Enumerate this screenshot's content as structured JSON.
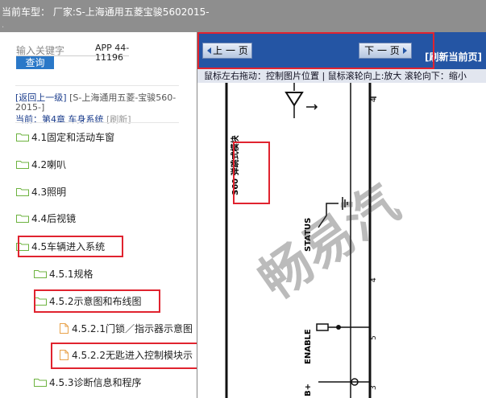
{
  "header": {
    "title": "当前车型：  厂家:S-上海通用五菱宝骏5602015-",
    "dot": "."
  },
  "search": {
    "placeholder": "输入关键字",
    "button": "查询",
    "app_code": "APP 44-11196"
  },
  "nav": {
    "back": "[返回上一级]",
    "vehicle": "[S-上海通用五菱-宝骏560-2015-]",
    "current_prefix": "当前：",
    "current": "第4章 车身系统",
    "refresh": "[刷新]"
  },
  "tree": [
    {
      "label": "4.1固定和活动车窗",
      "icon": "folder-icon"
    },
    {
      "label": "4.2喇叭",
      "icon": "folder-icon"
    },
    {
      "label": "4.3照明",
      "icon": "folder-icon"
    },
    {
      "label": "4.4后视镜",
      "icon": "folder-icon"
    },
    {
      "label": "4.5车辆进入系统",
      "icon": "folder-icon"
    },
    {
      "label": "4.5.1规格",
      "icon": "folder-icon"
    },
    {
      "label": "4.5.2示意图和布线图",
      "icon": "folder-icon"
    },
    {
      "label": "4.5.2.1门锁／指示器示意图",
      "icon": "document-icon"
    },
    {
      "label": "4.5.2.2无匙进入控制模块示",
      "icon": "document-icon"
    },
    {
      "label": "4.5.3诊断信息和程序",
      "icon": "folder-icon"
    }
  ],
  "viewer": {
    "prev": "上 一 页",
    "next": "下 一 页",
    "refresh": "[刷新当前页]",
    "hint": "鼠标左右拖动：控制图片位置 | 鼠标滚轮向上:放大  滚轮向下：缩小",
    "diagram": {
      "module_label": "S60 弹跳式模块",
      "status": "STATUS",
      "enable": "ENABLE",
      "bplus": "B+",
      "pins": [
        "4",
        "4",
        "5",
        "3"
      ]
    },
    "watermark": "畅易汽"
  },
  "colors": {
    "accent": "#2455a4",
    "highlight": "#e0232f",
    "folder": "#6db33f",
    "document": "#e8a24a"
  }
}
